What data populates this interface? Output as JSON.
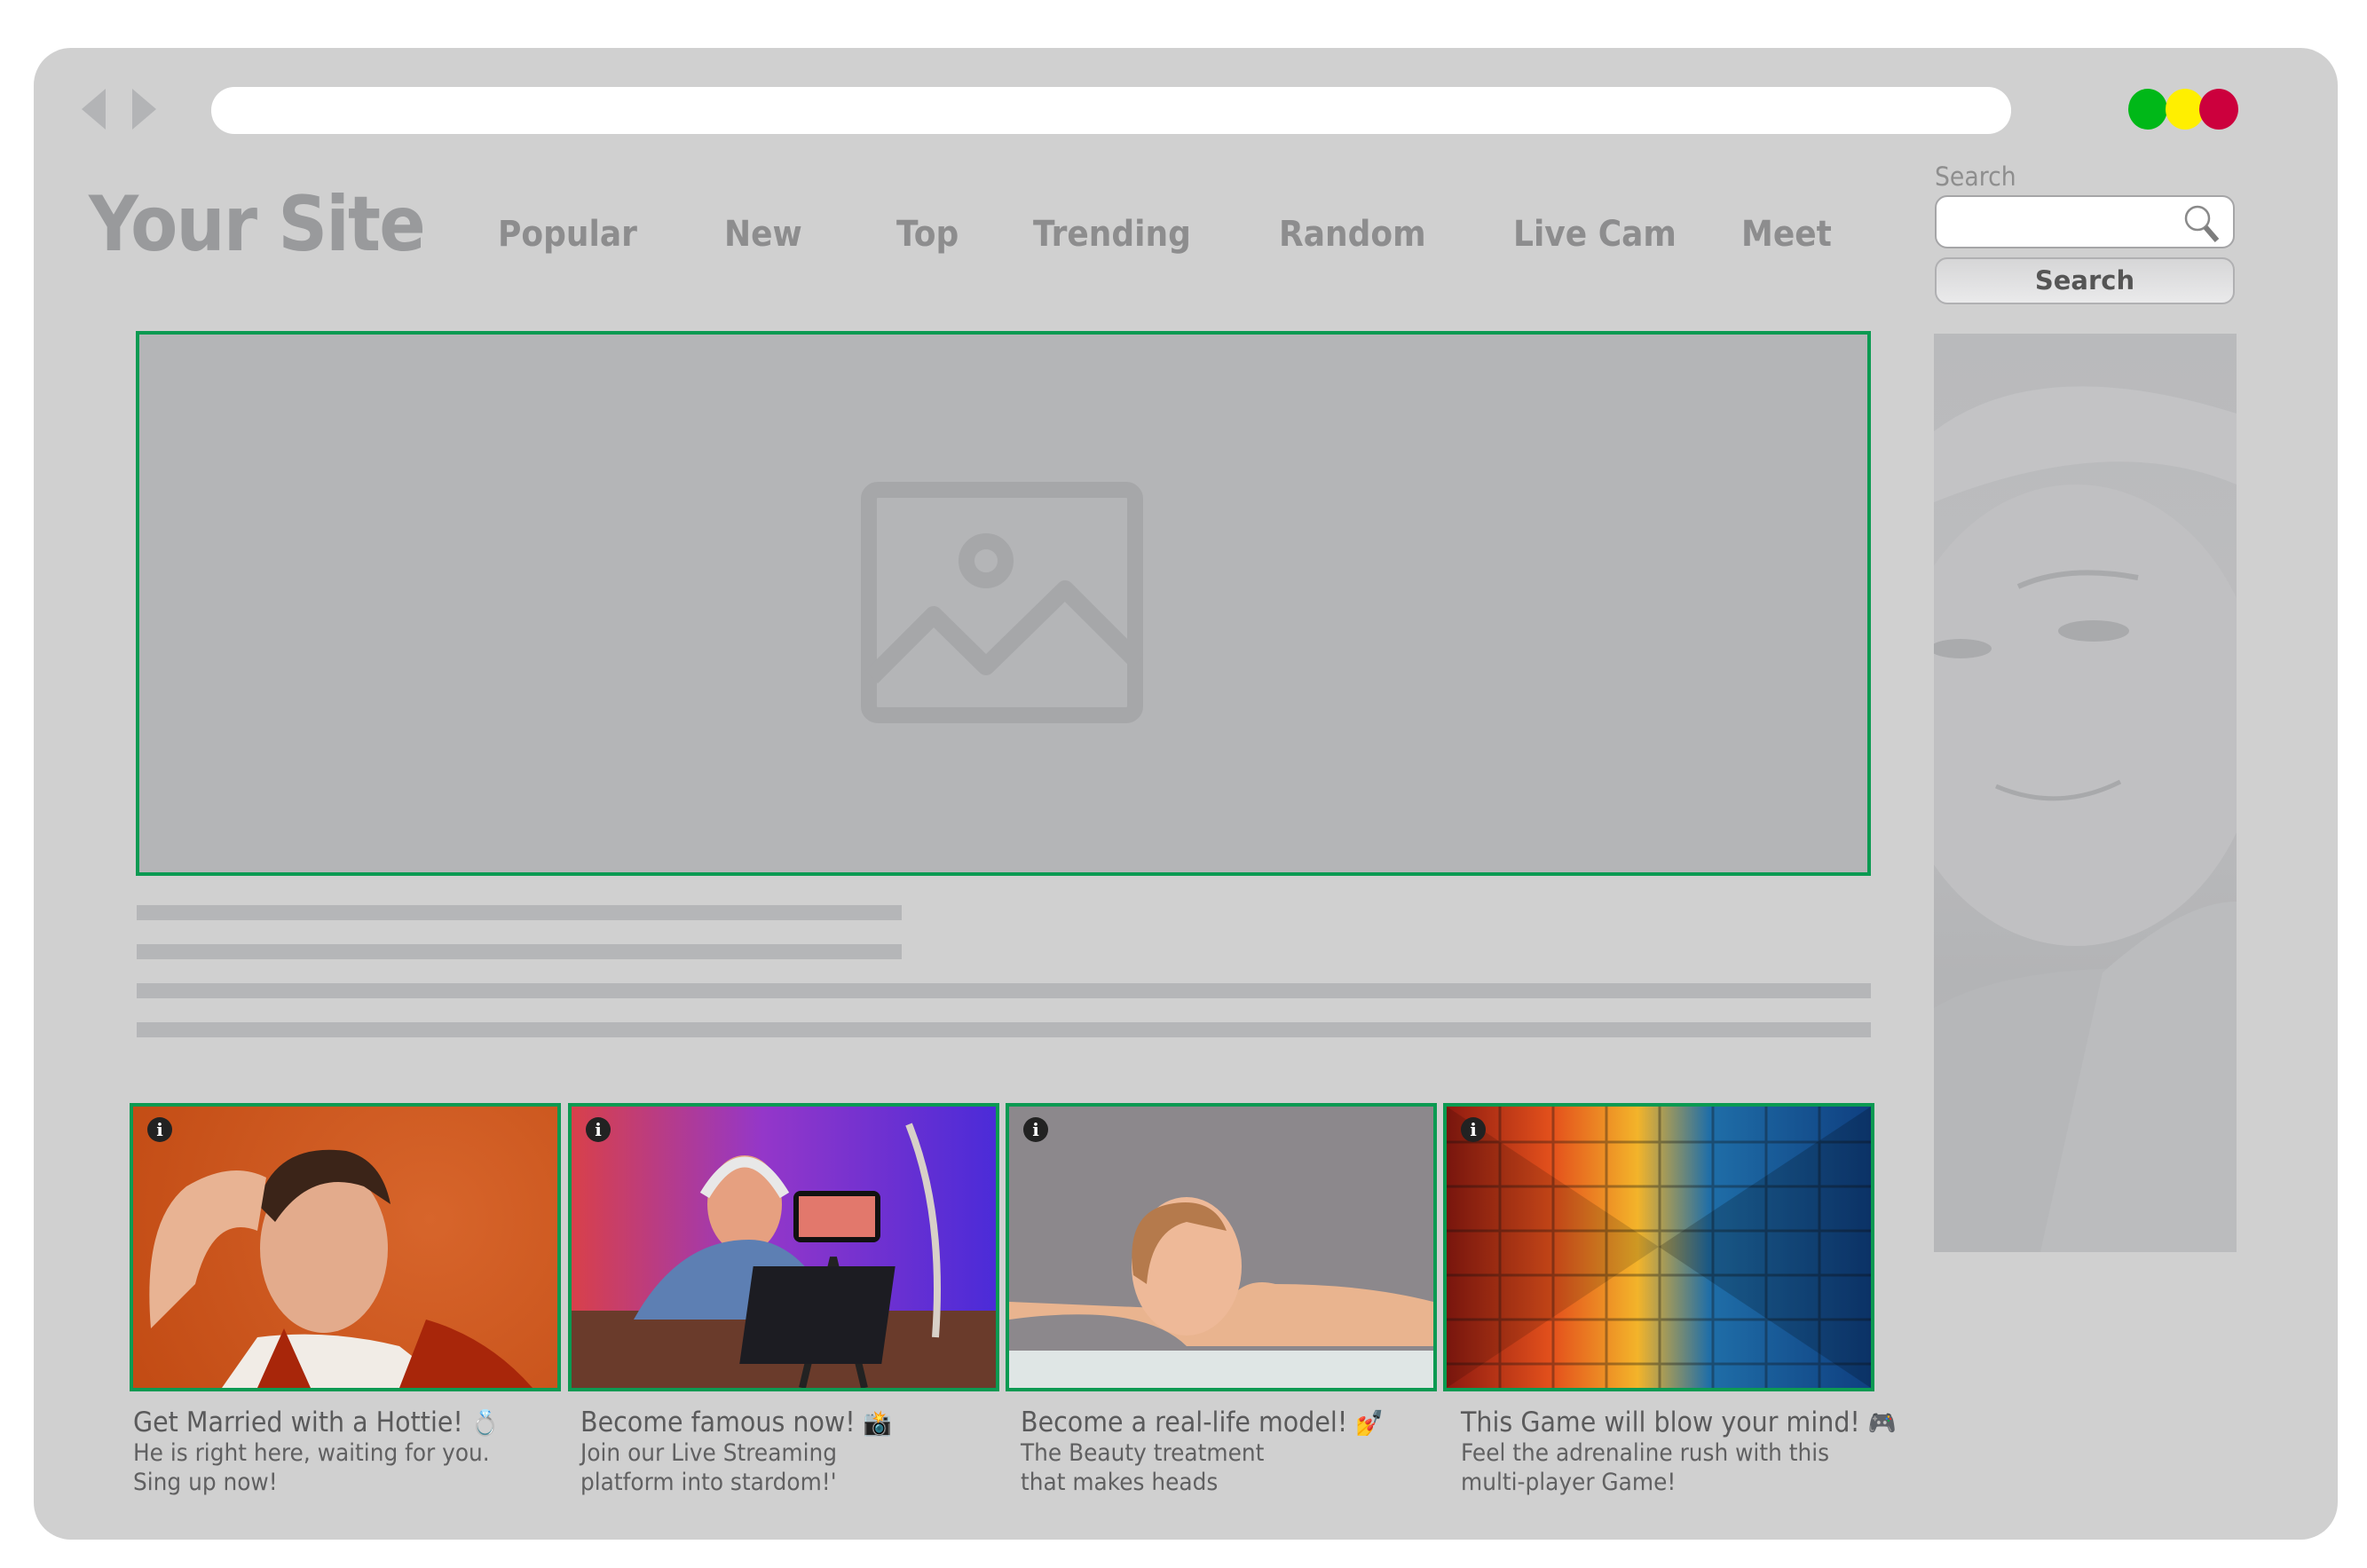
{
  "browser": {
    "url": "",
    "window_controls": [
      {
        "name": "green",
        "color": "#00b818"
      },
      {
        "name": "yellow",
        "color": "#ffef00"
      },
      {
        "name": "red",
        "color": "#cc003d"
      }
    ]
  },
  "header": {
    "logo": "Your Site",
    "nav": [
      "Popular",
      "New",
      "Top",
      "Trending",
      "Random",
      "Live Cam",
      "Meet"
    ]
  },
  "search": {
    "label": "Search",
    "input_value": "",
    "input_placeholder": "",
    "button_label": "Search"
  },
  "colors": {
    "window_bg": "#d0d0d0",
    "ad_border": "#0b9a52",
    "placeholder_fill": "#b4b5b7"
  },
  "hero": {
    "icon": "image-placeholder-icon"
  },
  "cards": [
    {
      "title": "Get Married with a Hottie!",
      "emoji": "💍",
      "line1": "He is right here, waiting for you.",
      "line2": "Sing up now!",
      "info_icon": "i"
    },
    {
      "title": "Become famous now!",
      "emoji": "📸",
      "line1": "Join our Live Streaming",
      "line2": "platform into stardom!'",
      "info_icon": "i"
    },
    {
      "title": "Become a real-life model!",
      "emoji": "💅",
      "line1": "The Beauty treatment",
      "line2": "that makes heads",
      "info_icon": "i"
    },
    {
      "title": "This Game will blow your mind!",
      "emoji": "🎮",
      "line1": "Feel the adrenaline rush with this",
      "line2": "multi-player Game!",
      "info_icon": "i"
    }
  ]
}
